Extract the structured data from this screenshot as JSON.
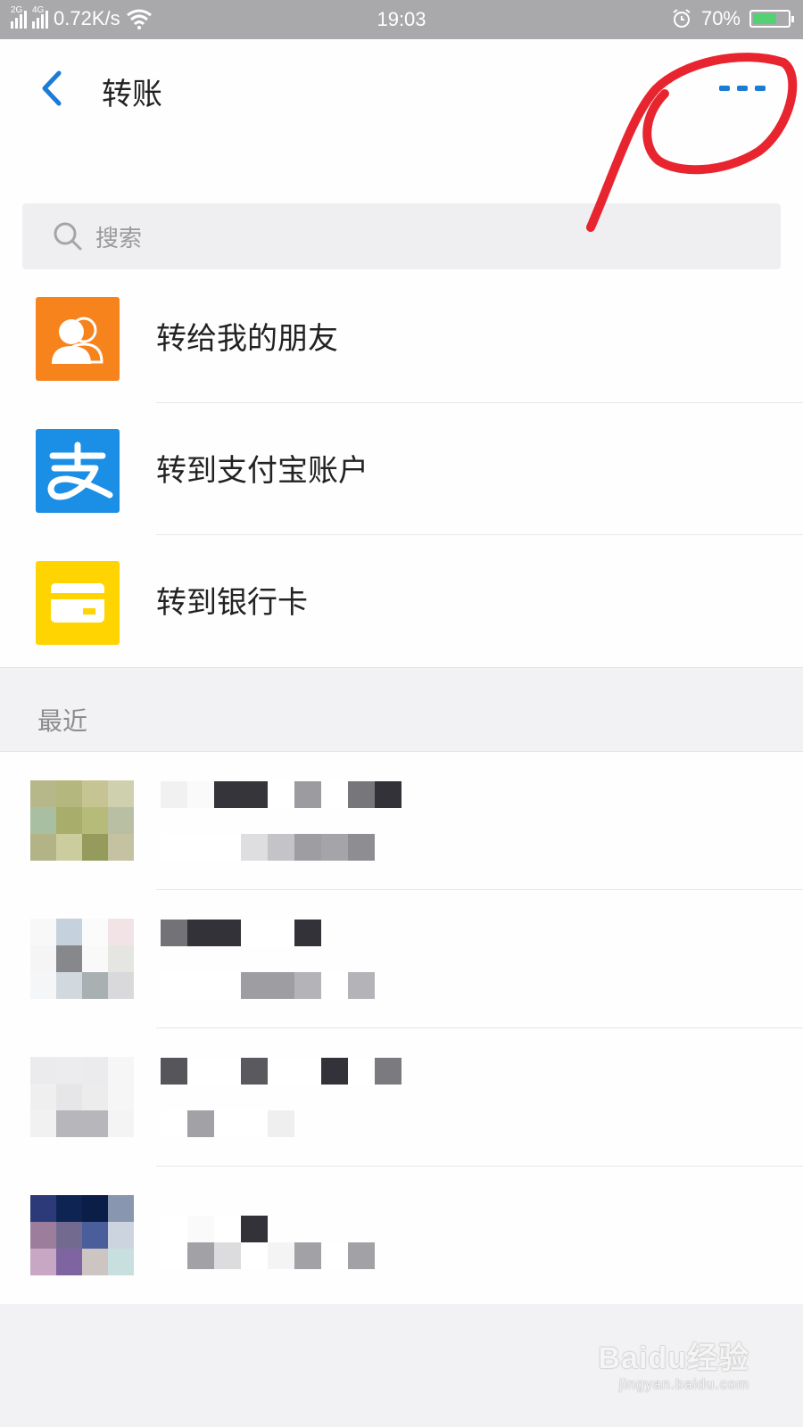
{
  "status_bar": {
    "net_left": "2G",
    "net_right": "4G",
    "speed": "0.72K/s",
    "time": "19:03",
    "battery": "70%",
    "battery_level": 0.7
  },
  "header": {
    "title": "转账"
  },
  "search": {
    "placeholder": "搜索"
  },
  "menu": [
    {
      "label": "转给我的朋友",
      "icon": "friends-icon",
      "color": "#f7831c"
    },
    {
      "label": "转到支付宝账户",
      "icon": "alipay-icon",
      "color": "#1b8ee6"
    },
    {
      "label": "转到银行卡",
      "icon": "bank-card-icon",
      "color": "#ffd400"
    }
  ],
  "recent": {
    "title": "最近"
  },
  "watermark": {
    "brand": "Baidu经验",
    "url": "jingyan.baidu.com"
  },
  "colors": {
    "accent": "#1b7bd6",
    "annotation": "#e8242f"
  }
}
